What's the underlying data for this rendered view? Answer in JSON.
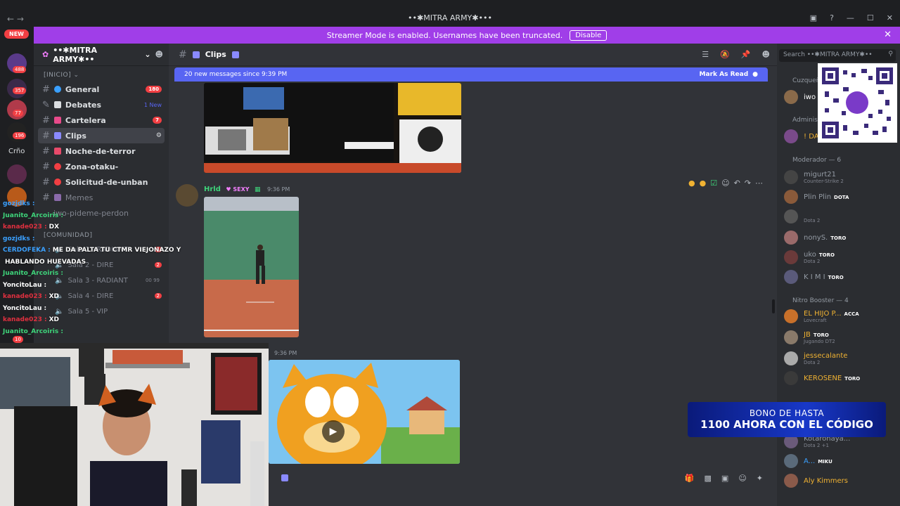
{
  "window": {
    "title": "••✱MITRA ARMY✱•••"
  },
  "banner": {
    "text": "Streamer Mode is enabled. Usernames have been truncated.",
    "button": "Disable"
  },
  "rail": {
    "new_label": "NEW",
    "badges": [
      "488",
      "357",
      "77",
      "196",
      "10"
    ],
    "server_text": "Crño"
  },
  "server": {
    "name": "••✱MITRA ARMY✱••"
  },
  "categories": {
    "inicio": "[INICIO]",
    "comunidad": "[COMUNIDAD]"
  },
  "channels": [
    {
      "name": "General",
      "count": "180"
    },
    {
      "name": "Debates",
      "count": "1 New"
    },
    {
      "name": "Cartelera",
      "count": "7"
    },
    {
      "name": "Clips",
      "count": ""
    },
    {
      "name": "Noche-de-terror",
      "count": ""
    },
    {
      "name": "Zona-otaku-",
      "count": ""
    },
    {
      "name": "Solicitud-de-unban",
      "count": ""
    },
    {
      "name": "Memes",
      "count": ""
    },
    {
      "name": "iwo-pideme-perdon",
      "count": ""
    }
  ],
  "voice": [
    {
      "name": "Sala 1 - RADIANT",
      "badge": "1"
    },
    {
      "name": "Sala 2 - DIRE",
      "badge": "2"
    },
    {
      "name": "Sala 3 - RADIANT",
      "badge": "00 99"
    },
    {
      "name": "Sala 4 - DIRE",
      "badge": "2"
    },
    {
      "name": "Sala 5 - VIP",
      "badge": ""
    }
  ],
  "stream_chat": [
    {
      "user": "gozjdks :",
      "msg": "",
      "color": "u-blue"
    },
    {
      "user": "Juanito_Arcoiris :",
      "msg": "",
      "color": "u-green"
    },
    {
      "user": "kanade023 :",
      "msg": "DX",
      "color": "u-red"
    },
    {
      "user": "gozjdks :",
      "msg": "",
      "color": "u-blue"
    },
    {
      "user": "CERDOFEKA :",
      "msg": "ME DA PALTA TU CTMR VIEJONAZO Y",
      "color": "u-blue"
    },
    {
      "user": "",
      "msg": "HABLANDO HUEVADAS",
      "color": "u-white"
    },
    {
      "user": "Juanito_Arcoiris :",
      "msg": "",
      "color": "u-green"
    },
    {
      "user": "YoncitoLau :",
      "msg": "",
      "color": "u-white"
    },
    {
      "user": "kanade023 :",
      "msg": "XD",
      "color": "u-red"
    },
    {
      "user": "YoncitoLau :",
      "msg": "",
      "color": "u-white"
    },
    {
      "user": "kanade023 :",
      "msg": "XD",
      "color": "u-red"
    },
    {
      "user": "Juanito_Arcoiris :",
      "msg": "",
      "color": "u-green"
    }
  ],
  "main": {
    "channel_title": "Clips",
    "new_messages": "20 new messages since 9:39 PM",
    "mark_read": "Mark As Read",
    "message": {
      "author": "Hrld",
      "tag": "SEXY",
      "time": "9:36 PM"
    },
    "second_time": "9:36 PM"
  },
  "search": {
    "placeholder": "Search ••✱MITRA ARMY✱••"
  },
  "members": {
    "roles": [
      "Cuzqueño",
      "Administ",
      "Moderador — 6",
      "Nitro Booster — 4"
    ],
    "list": [
      {
        "name": "iwo",
        "sub": "",
        "pill": "",
        "color": "#ffffff"
      },
      {
        "name": "! DA",
        "sub": "",
        "pill": "",
        "color": "#f0b232"
      },
      {
        "name": "migurt21",
        "sub": "Counter-Strike 2",
        "pill": "",
        "color": "#949ba4"
      },
      {
        "name": "Plin Plin",
        "sub": "",
        "pill": "DOTA",
        "color": "#949ba4"
      },
      {
        "name": "",
        "sub": "Dota 2",
        "pill": "",
        "color": "#949ba4"
      },
      {
        "name": "nonyS.",
        "sub": "",
        "pill": "TORO",
        "color": "#949ba4"
      },
      {
        "name": "uko",
        "sub": "Dota 2",
        "pill": "TORO",
        "color": "#949ba4"
      },
      {
        "name": "K I M I",
        "sub": "",
        "pill": "TORO",
        "color": "#949ba4"
      },
      {
        "name": "EL HIJO P...",
        "sub": "Lovecraft",
        "pill": "ACCA",
        "color": "#f0b232"
      },
      {
        "name": "JB",
        "sub": "Jugando DT2",
        "pill": "TORO",
        "color": "#f0b232"
      },
      {
        "name": "jessecalante",
        "sub": "Dota 2",
        "pill": "",
        "color": "#f0b232"
      },
      {
        "name": "KEROSENE",
        "sub": "",
        "pill": "TORO",
        "color": "#f0b232"
      },
      {
        "name": "Kotaronaya...",
        "sub": "Dota 2 +1",
        "pill": "",
        "color": "#949ba4"
      },
      {
        "name": "A...",
        "sub": "",
        "pill": "MIKU",
        "color": "#3aa0ff"
      },
      {
        "name": "Aly Kimmers",
        "sub": "",
        "pill": "",
        "color": "#f0b232"
      }
    ]
  },
  "promo": {
    "line1": "BONO DE HASTA",
    "line2": "1100 AHORA CON EL CÓDIGO"
  }
}
